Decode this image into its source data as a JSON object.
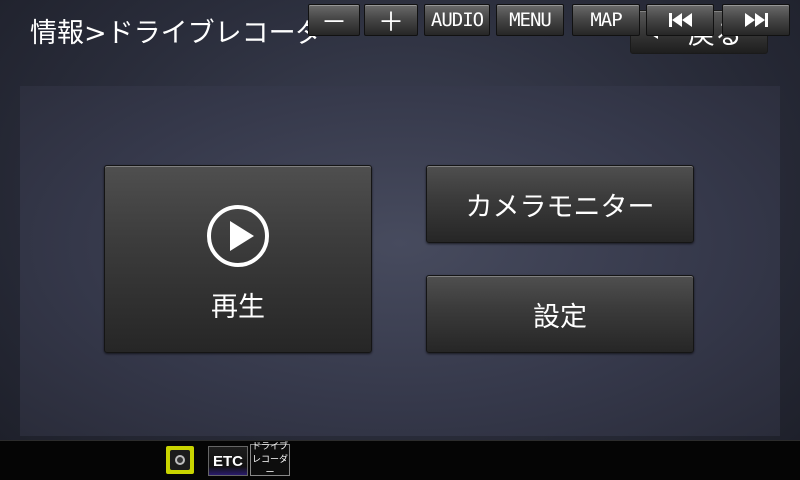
{
  "header": {
    "title": "情報>ドライブレコーダー",
    "back_label": "戻る"
  },
  "menu": {
    "play_label": "再生",
    "camera_monitor_label": "カメラモニター",
    "settings_label": "設定"
  },
  "status_icons": {
    "etc_label": "ETC",
    "drive_recorder_line1": "ドライブ",
    "drive_recorder_line2": "レコーダー",
    "camera_indicator_color": "#c9d400"
  },
  "bottom_bar": {
    "minus_label": "－",
    "plus_label": "＋",
    "audio_label": "AUDIO",
    "menu_label": "MENU",
    "map_label": "MAP"
  },
  "icons": {
    "back": "triangle-left-icon",
    "play": "play-circle-icon",
    "prev_track": "skip-previous-icon",
    "next_track": "skip-next-icon",
    "camera_status": "camera-icon"
  }
}
